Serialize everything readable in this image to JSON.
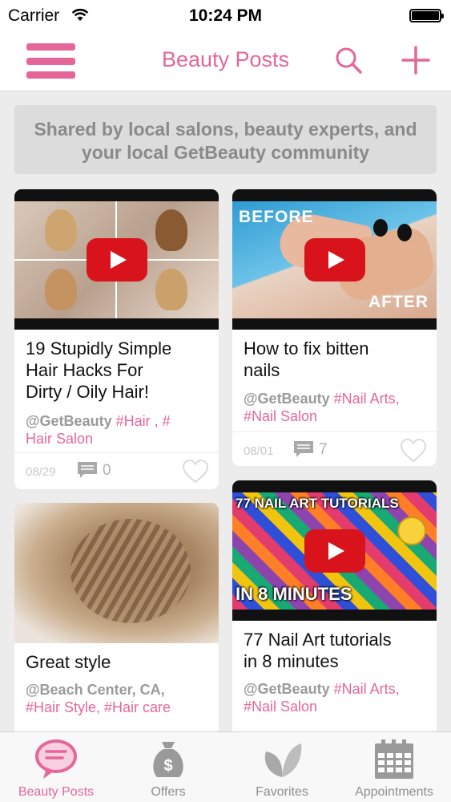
{
  "status_bar": {
    "carrier": "Carrier",
    "time": "10:24 PM"
  },
  "header": {
    "title": "Beauty Posts"
  },
  "banner": {
    "line1": "Shared by local salons, beauty experts, and",
    "line2": "your local GetBeauty community"
  },
  "posts": [
    {
      "title_lines": [
        "19 Stupidly Simple",
        "Hair Hacks For",
        "Dirty / Oily Hair!"
      ],
      "author": "@GetBeauty",
      "tag1": "#Hair , #",
      "tag2": "Hair Salon",
      "date": "08/29",
      "comments": "0",
      "has_video": true
    },
    {
      "title_lines": [
        "How to fix bitten",
        "nails"
      ],
      "author": "@GetBeauty",
      "tag1": "#Nail Arts,",
      "tag2": "#Nail Salon",
      "date": "08/01",
      "comments": "7",
      "has_video": true,
      "thumb_text_top": "BEFORE",
      "thumb_text_bottom": "AFTER"
    },
    {
      "title_lines": [
        "Great style"
      ],
      "author": "@Beach Center, CA,",
      "tag1": "#Hair Style, #Hair care",
      "has_video": false
    },
    {
      "title_lines": [
        "77 Nail Art tutorials",
        "in 8 minutes"
      ],
      "author": "@GetBeauty",
      "tag1": "#Nail Arts,",
      "tag2": "#Nail Salon",
      "has_video": true,
      "thumb_text_top": "77 NAIL ART TUTORIALS",
      "thumb_text_bottom": "IN 8 MINUTES"
    }
  ],
  "tabs": [
    {
      "label": "Beauty Posts",
      "icon": "chat-bubble-icon",
      "active": true
    },
    {
      "label": "Offers",
      "icon": "money-bag-icon",
      "active": false
    },
    {
      "label": "Favorites",
      "icon": "leaves-icon",
      "active": false
    },
    {
      "label": "Appointments",
      "icon": "calendar-icon",
      "active": false
    }
  ],
  "colors": {
    "accent": "#e5679a",
    "play_red": "#d8131b",
    "muted": "#8e8e8e"
  }
}
